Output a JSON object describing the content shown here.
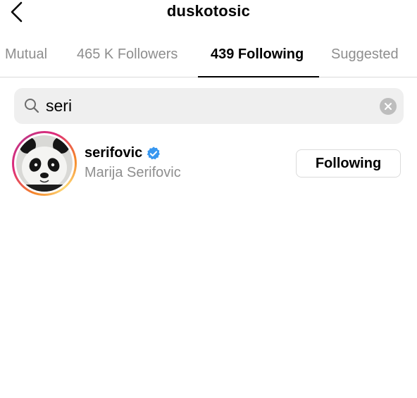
{
  "header": {
    "title": "duskotosic",
    "back_icon": "chevron-left-icon"
  },
  "tabs": [
    {
      "label": "Mutual",
      "active": false
    },
    {
      "label": "465 K Followers",
      "active": false
    },
    {
      "label": "439 Following",
      "active": true
    },
    {
      "label": "Suggested",
      "active": false
    }
  ],
  "search": {
    "value": "seri",
    "search_icon": "magnifier-icon",
    "clear_icon": "clear-x-icon"
  },
  "results": [
    {
      "username": "serifovic",
      "verified": true,
      "full_name": "Marija Serifovic",
      "button_label": "Following",
      "avatar_icon": "panda-avatar"
    }
  ],
  "colors": {
    "muted_text": "#8e8e8e",
    "verified_blue": "#3897f0",
    "search_bg": "#efefef",
    "border": "#dbdbdb"
  }
}
